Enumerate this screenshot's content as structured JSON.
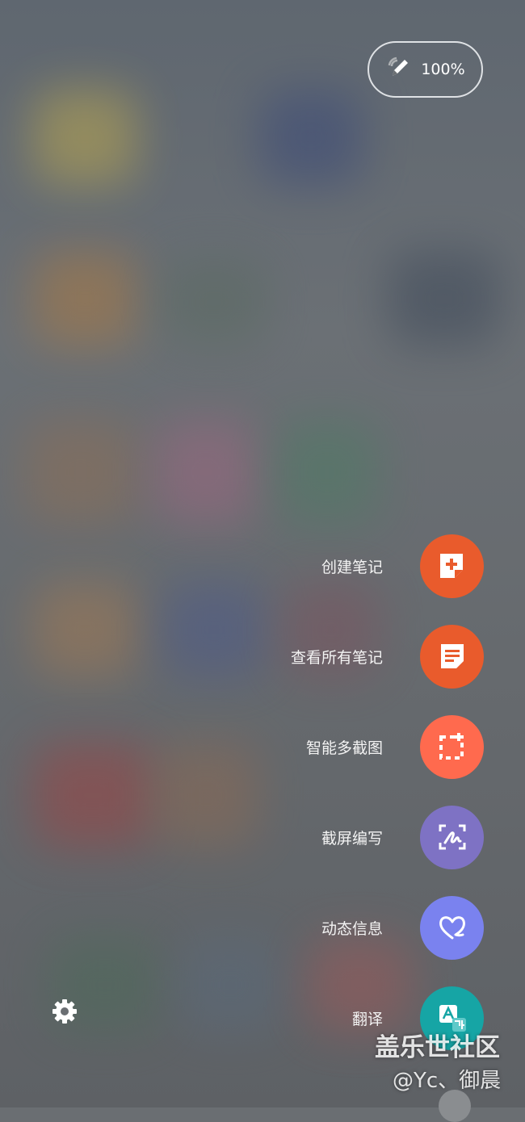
{
  "pen_status": {
    "battery": "100%",
    "icon": "spen-icon"
  },
  "actions": [
    {
      "label": "创建笔记",
      "icon": "create-note-icon",
      "color": "#e95b2c"
    },
    {
      "label": "查看所有笔记",
      "icon": "view-notes-icon",
      "color": "#e95b2c"
    },
    {
      "label": "智能多截图",
      "icon": "smart-select-icon",
      "color": "#ff6a4e"
    },
    {
      "label": "截屏编写",
      "icon": "screen-write-icon",
      "color": "#7e72c4"
    },
    {
      "label": "动态信息",
      "icon": "live-message-icon",
      "color": "#7a82ef"
    },
    {
      "label": "翻译",
      "icon": "translate-icon",
      "color": "#16a5a5"
    }
  ],
  "settings": {
    "icon": "gear-icon"
  },
  "watermark": {
    "line1": "盖乐世社区",
    "line2": "@Yc、御晨"
  }
}
